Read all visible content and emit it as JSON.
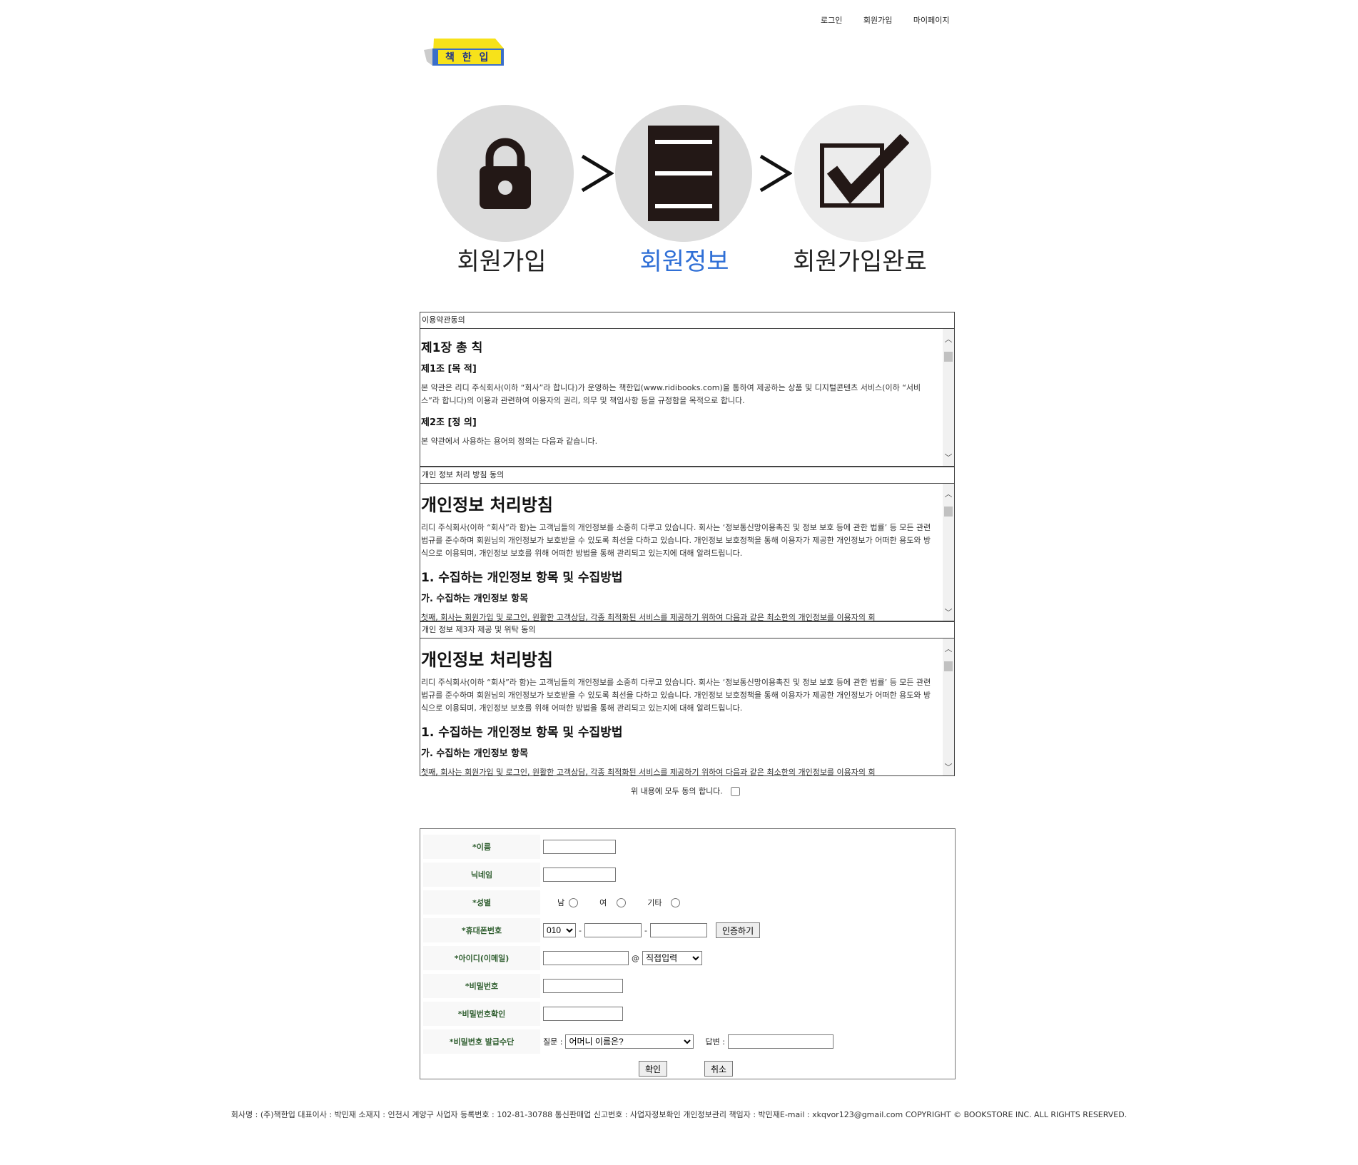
{
  "nav": {
    "login": "로그인",
    "signup": "회원가입",
    "mypage": "마이페이지"
  },
  "logo": {
    "text": "책 한 입"
  },
  "steps": [
    {
      "label": "회원가입",
      "icon": "lock-icon"
    },
    {
      "label": "회원정보",
      "icon": "document-icon",
      "active": true
    },
    {
      "label": "회원가입완료",
      "icon": "checkbox-icon"
    }
  ],
  "terms": [
    {
      "header": "이용약관동의",
      "h3": "제1장 총 칙",
      "h4a": "제1조 [목 적]",
      "p1": "본 약관은 리디 주식회사(이하 “회사”라 합니다)가 운영하는 책한입(www.ridibooks.com)을 통하여 제공하는 상품 및 디지털콘텐츠 서비스(이하 “서비스”라 합니다)의 이용과 관련하여 이용자의 권리, 의무 및 책임사항 등을 규정함을 목적으로 합니다.",
      "h4b": "제2조 [정 의]",
      "p2": "본 약관에서 사용하는 용어의 정의는 다음과 같습니다."
    },
    {
      "header": "개인 정보 처리 방침 동의",
      "h2": "개인정보 처리방침",
      "p1": "리디 주식회사(이하 “회사”라 함)는 고객님들의 개인정보를 소중히 다루고 있습니다. 회사는 ‘정보통신망이용촉진 및 정보 보호 등에 관한 법률’ 등 모든 관련 법규를 준수하며 회원님의 개인정보가 보호받을 수 있도록 최선을 다하고 있습니다. 개인정보 보호정책을 통해 이용자가 제공한 개인정보가 어떠한 용도와 방식으로 이용되며, 개인정보 보호를 위해 어떠한 방법을 통해 관리되고 있는지에 대해 알려드립니다.",
      "h3": "1. 수집하는 개인정보 항목 및 수집방법",
      "h4": "가. 수집하는 개인정보 항목",
      "p2": "첫째, 회사는 회원가입 및 로그인, 원활한 고객상담, 각종 최적화된 서비스를 제공하기 위하여 다음과 같은 최소한의 개인정보를 이용자의 회"
    },
    {
      "header": "개인 정보 제3자 제공 및 위탁 동의",
      "h2": "개인정보 처리방침",
      "p1": "리디 주식회사(이하 “회사”라 함)는 고객님들의 개인정보를 소중히 다루고 있습니다. 회사는 ‘정보통신망이용촉진 및 정보 보호 등에 관한 법률’ 등 모든 관련 법규를 준수하며 회원님의 개인정보가 보호받을 수 있도록 최선을 다하고 있습니다. 개인정보 보호정책을 통해 이용자가 제공한 개인정보가 어떠한 용도와 방식으로 이용되며, 개인정보 보호를 위해 어떠한 방법을 통해 관리되고 있는지에 대해 알려드립니다.",
      "h3": "1. 수집하는 개인정보 항목 및 수집방법",
      "h4": "가. 수집하는 개인정보 항목",
      "p2": "첫째, 회사는 회원가입 및 로그인, 원활한 고객상담, 각종 최적화된 서비스를 제공하기 위하여 다음과 같은 최소한의 개인정보를 이용자의 회"
    }
  ],
  "agree_text": "위 내용에 모두 동의 합니다.",
  "form": {
    "name": "*이름",
    "nickname": "닉네임",
    "gender": "*성별",
    "gender_options": [
      "남",
      "여",
      "기타"
    ],
    "phone": "*휴대폰번호",
    "phone_prefix": "010",
    "phone_sep": "-",
    "verify_btn": "인증하기",
    "email": "*아이디(이메일)",
    "at": "@",
    "email_domain": "직접입력",
    "password": "*비밀번호",
    "password_confirm": "*비밀번호확인",
    "recovery": "*비밀번호 발급수단",
    "question_label": "질문 :",
    "question_value": "어머니 이름은?",
    "answer_label": "답변 :",
    "confirm_btn": "확인",
    "cancel_btn": "취소"
  },
  "footer": "회사명 : (주)책한입 대표이사 : 박민재 소재지 : 인천시 계양구 사업자 등록번호 : 102-81-30788 통신판매업 신고번호 : 사업자정보확인 개인정보관리 책임자 : 박민재E-mail : xkqvor123@gmail.com COPYRIGHT © BOOKSTORE INC. ALL RIGHTS RESERVED."
}
